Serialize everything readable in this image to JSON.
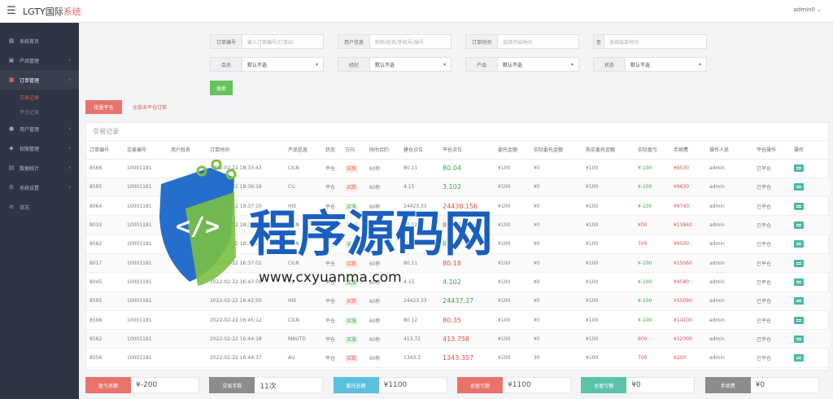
{
  "header": {
    "title_main": "LGTY国际",
    "title_accent": "系统",
    "user": "admin0 ⌄"
  },
  "sidebar": {
    "items": [
      {
        "label": "系统首页",
        "icon": "dashboard-icon"
      },
      {
        "label": "产品管理",
        "icon": "box-icon"
      },
      {
        "label": "订单管理",
        "icon": "order-icon"
      },
      {
        "label": "用户管理",
        "icon": "user-icon"
      },
      {
        "label": "权限管理",
        "icon": "shield-icon"
      },
      {
        "label": "数据统计",
        "icon": "chart-icon"
      },
      {
        "label": "系统设置",
        "icon": "gear-icon"
      },
      {
        "label": "日志",
        "icon": "log-icon"
      }
    ],
    "sub_items": [
      "交易记录",
      "平仓记录"
    ]
  },
  "filters": {
    "order_no": {
      "label": "订单编号",
      "placeholder": "输入订单编号/订单ID"
    },
    "user_info": {
      "label": "用户信息",
      "placeholder": "昵称/姓名/手机号/编号"
    },
    "order_time": {
      "label": "订单时间",
      "placeholder": "选择开始时间"
    },
    "to": {
      "label": "至",
      "placeholder": "选择结束时间"
    },
    "member": {
      "label": "会员",
      "value": "默认不选"
    },
    "agent": {
      "label": "经纪",
      "value": "默认不选"
    },
    "product": {
      "label": "产品",
      "value": "默认不选"
    },
    "status": {
      "label": "状态",
      "value": "默认不选"
    },
    "search_button": "搜索"
  },
  "actions": {
    "batch_close": "批量平仓",
    "unclosed_link": "全部未平仓订单"
  },
  "panel": {
    "title": "交易记录"
  },
  "table": {
    "headers": [
      "订单编号",
      "交易编号",
      "用户姓名",
      "订单时间",
      "产品信息",
      "状态",
      "方向",
      "时间合约",
      "建仓点位",
      "平仓点位",
      "委托金额",
      "实际委托金额",
      "购买委托金额",
      "实际盈亏",
      "手续费",
      "操作人员",
      "平仓操作",
      "操作"
    ],
    "rows": [
      {
        "order": "8566",
        "trade": "10001181",
        "user": "",
        "time": "2022-02-22 18:33:43",
        "product": "CILN",
        "status": "平仓",
        "dir": "买跌",
        "dir_type": "sell",
        "contract": "60秒",
        "open": "80.11",
        "close": "80.04",
        "close_color": "green",
        "amount": "¥100",
        "actual": "¥0",
        "buy": "¥100",
        "pnl": "¥-100",
        "pnl_color": "neg",
        "balance": "¥9530",
        "op": "admin",
        "close_op": "已平仓"
      },
      {
        "order": "8595",
        "trade": "10001181",
        "user": "",
        "time": "2022-02-22 18:36:18",
        "product": "CU",
        "status": "平仓",
        "dir": "买跌",
        "dir_type": "sell",
        "contract": "60秒",
        "open": "4.15",
        "close": "3.102",
        "close_color": "green",
        "amount": "¥100",
        "actual": "¥0",
        "buy": "¥100",
        "pnl": "¥-100",
        "pnl_color": "neg",
        "balance": "¥9630",
        "op": "admin",
        "close_op": "已平仓"
      },
      {
        "order": "8064",
        "trade": "10001181",
        "user": "",
        "time": "2022-02-22 18:37:10",
        "product": "HIS",
        "status": "平仓",
        "dir": "买涨",
        "dir_type": "buy",
        "contract": "60秒",
        "open": "24423.33",
        "close": "24438.156",
        "close_color": "red",
        "amount": "¥100",
        "actual": "¥0",
        "buy": "¥100",
        "pnl": "¥-100",
        "pnl_color": "neg",
        "balance": "¥9740",
        "op": "admin",
        "close_op": "已平仓"
      },
      {
        "order": "8032",
        "trade": "10001181",
        "user": "",
        "time": "2022-02-22 18:38:22",
        "product": "CILN",
        "status": "平仓",
        "dir": "买涨",
        "dir_type": "buy",
        "contract": "60秒",
        "open": "80.12",
        "close": "80.76",
        "close_color": "red",
        "amount": "¥100",
        "actual": "¥0",
        "buy": "¥100",
        "pnl": "¥00",
        "pnl_color": "pos",
        "balance": "¥13840",
        "op": "admin",
        "close_op": "已平仓"
      },
      {
        "order": "8582",
        "trade": "10001181",
        "user": "",
        "time": "2022-02-22 18:39:05",
        "product": "CILN",
        "status": "平仓",
        "dir": "买涨",
        "dir_type": "buy",
        "contract": "60秒",
        "open": "80.12",
        "close": "80.97",
        "close_color": "green",
        "amount": "¥100",
        "actual": "¥0",
        "buy": "¥100",
        "pnl": "700",
        "pnl_color": "pos",
        "balance": "¥9500",
        "op": "admin",
        "close_op": "已平仓"
      },
      {
        "order": "8017",
        "trade": "10001181",
        "user": "",
        "time": "2022-02-22 16:37:02",
        "product": "CILN",
        "status": "平仓",
        "dir": "买跌",
        "dir_type": "sell",
        "contract": "60秒",
        "open": "80.11",
        "close": "80.18",
        "close_color": "red",
        "amount": "¥100",
        "actual": "¥0",
        "buy": "¥100",
        "pnl": "¥-100",
        "pnl_color": "neg",
        "balance": "¥15060",
        "op": "admin",
        "close_op": "已平仓"
      },
      {
        "order": "8045",
        "trade": "10001181",
        "user": "",
        "time": "2022-02-22 16:43:59",
        "product": "CU",
        "status": "平仓",
        "dir": "买涨",
        "dir_type": "buy",
        "contract": "60秒",
        "open": "4.15",
        "close": "4.102",
        "close_color": "green",
        "amount": "¥100",
        "actual": "¥0",
        "buy": "¥100",
        "pnl": "¥-100",
        "pnl_color": "neg",
        "balance": "¥9580",
        "op": "admin",
        "close_op": "已平仓"
      },
      {
        "order": "8595",
        "trade": "10001181",
        "user": "",
        "time": "2022-02-22 16:42:50",
        "product": "HIS",
        "status": "平仓",
        "dir": "买跌",
        "dir_type": "sell",
        "contract": "60秒",
        "open": "24423.33",
        "close": "24437.37",
        "close_color": "green",
        "amount": "¥100",
        "actual": "¥0",
        "buy": "¥100",
        "pnl": "¥-100",
        "pnl_color": "neg",
        "balance": "¥15090",
        "op": "admin",
        "close_op": "已平仓"
      },
      {
        "order": "8598",
        "trade": "10001181",
        "user": "",
        "time": "2022-02-22 16:45:12",
        "product": "CILN",
        "status": "平仓",
        "dir": "买涨",
        "dir_type": "buy",
        "contract": "60秒",
        "open": "80.12",
        "close": "80.35",
        "close_color": "red",
        "amount": "¥100",
        "actual": "¥0",
        "buy": "¥100",
        "pnl": "¥-100",
        "pnl_color": "neg",
        "balance": "¥14100",
        "op": "admin",
        "close_op": "已平仓"
      },
      {
        "order": "8562",
        "trade": "10001181",
        "user": "",
        "time": "2022-02-22 16:44:18",
        "product": "MAUTD",
        "status": "平仓",
        "dir": "买涨",
        "dir_type": "buy",
        "contract": "60秒",
        "open": "413.72",
        "close": "413.758",
        "close_color": "red",
        "amount": "¥100",
        "actual": "¥0",
        "buy": "¥100",
        "pnl": "900",
        "pnl_color": "pos",
        "balance": "¥12300",
        "op": "admin",
        "close_op": "已平仓"
      },
      {
        "order": "8556",
        "trade": "10001181",
        "user": "",
        "time": "2022-02-22 16:44:37",
        "product": "AU",
        "status": "平仓",
        "dir": "买跌",
        "dir_type": "sell",
        "contract": "60秒",
        "open": "1343.3",
        "close": "1343.357",
        "close_color": "red",
        "amount": "¥100",
        "actual": "30",
        "buy": "¥100",
        "pnl": "700",
        "pnl_color": "pos",
        "balance": "¥200",
        "op": "admin",
        "close_op": "已平仓"
      }
    ]
  },
  "summary": [
    {
      "label": "盈亏总额",
      "value": "¥-200",
      "color": "#e9736c"
    },
    {
      "label": "交易手数",
      "value": "11次",
      "color": "#8c8c8c"
    },
    {
      "label": "委托总额",
      "value": "¥1100",
      "color": "#5bc0de"
    },
    {
      "label": "总盈亏额",
      "value": "¥1100",
      "color": "#e9736c"
    },
    {
      "label": "总盈亏额",
      "value": "¥0",
      "color": "#5cc3a8"
    },
    {
      "label": "手续费",
      "value": "¥0",
      "color": "#8c8c8c"
    }
  ],
  "watermark": {
    "title": "程序源码网",
    "url": "www.cxyuanma.com"
  }
}
